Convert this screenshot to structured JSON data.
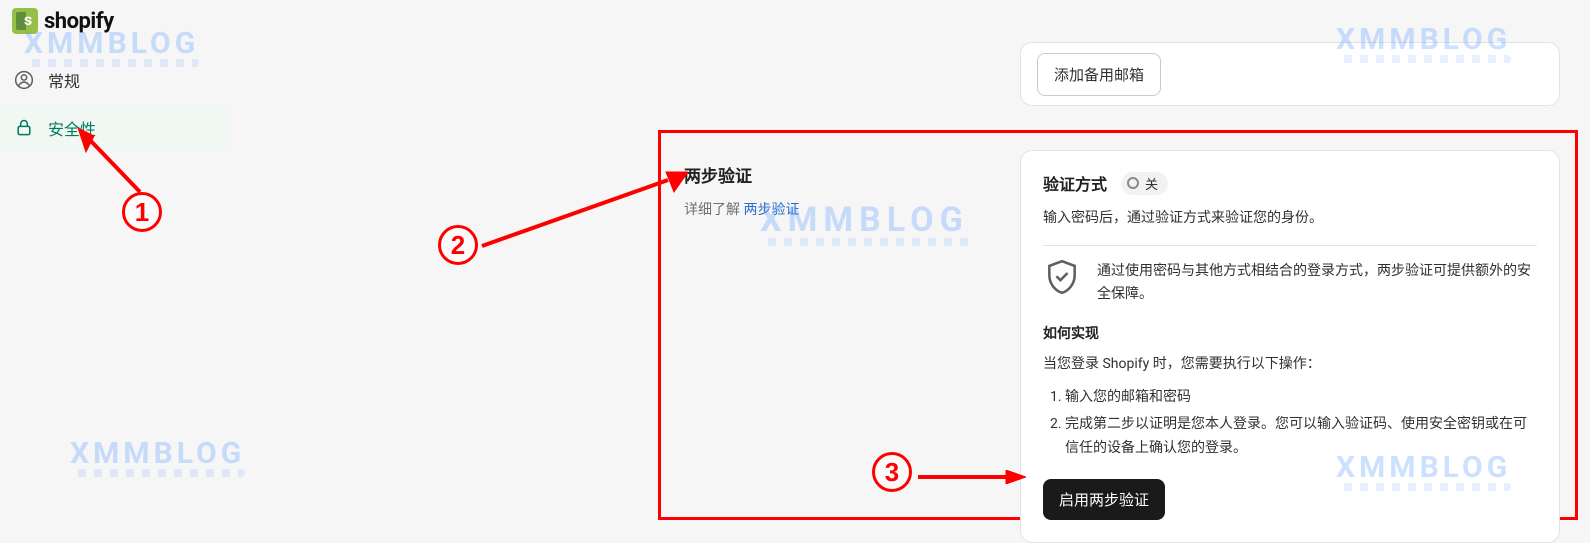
{
  "logo_text": "shopify",
  "sidebar": {
    "general_label": "常规",
    "security_label": "安全性"
  },
  "top_panel": {
    "add_backup_email_label": "添加备用邮箱"
  },
  "section": {
    "title": "两步验证",
    "learn_prefix": "详细了解 ",
    "learn_link": "两步验证"
  },
  "panel": {
    "method_title": "验证方式",
    "status_label": "关",
    "desc": "输入密码后，通过验证方式来验证您的身份。",
    "shield_text": "通过使用密码与其他方式相结合的登录方式，两步验证可提供额外的安全保障。",
    "howto_title": "如何实现",
    "howto_lead": "当您登录 Shopify 时，您需要执行以下操作：",
    "step1": "输入您的邮箱和密码",
    "step2": "完成第二步以证明是您本人登录。您可以输入验证码、使用安全密钥或在可信任的设备上确认您的登录。",
    "enable_button": "启用两步验证"
  },
  "annotations": {
    "one": "1",
    "two": "2",
    "three": "3"
  },
  "watermark": "XMMBLOG"
}
